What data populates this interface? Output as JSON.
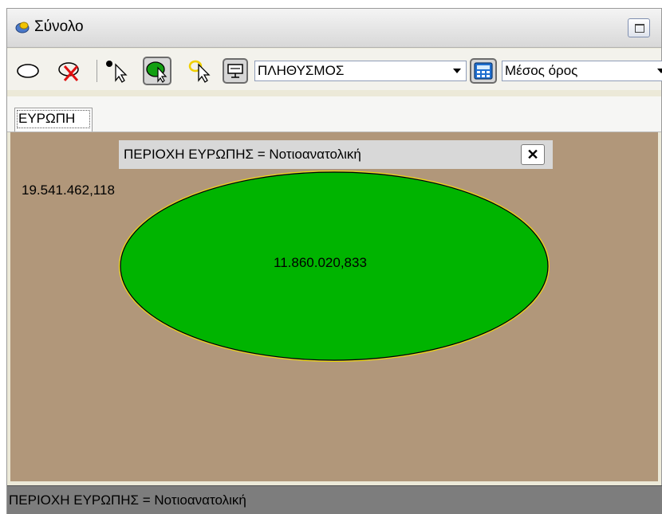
{
  "window": {
    "title": "Σύνολο"
  },
  "toolbar": {
    "items": [
      "ellipse-select-icon",
      "clear-selection-icon",
      "point-select-icon",
      "region-select-icon",
      "pointer-icon",
      "display-icon",
      "calculator-icon"
    ],
    "variable_combo": "ΠΛΗΘΥΣΜΟΣ",
    "aggregate_combo": "Μέσος όρος"
  },
  "tabs": {
    "active": "ΕΥΡΩΠΗ"
  },
  "canvas": {
    "background_color": "#b1977a",
    "filter_text": "ΠΕΡΙΟΧΗ ΕΥΡΩΠΗΣ = Νοτιοανατολική",
    "close_label": "✕",
    "total_value": "19.541.462,118",
    "ellipse_value": "11.860.020,833",
    "ellipse_color": "#00b400"
  },
  "statusbar": {
    "text": "ΠΕΡΙΟΧΗ ΕΥΡΩΠΗΣ = Νοτιοανατολική"
  }
}
